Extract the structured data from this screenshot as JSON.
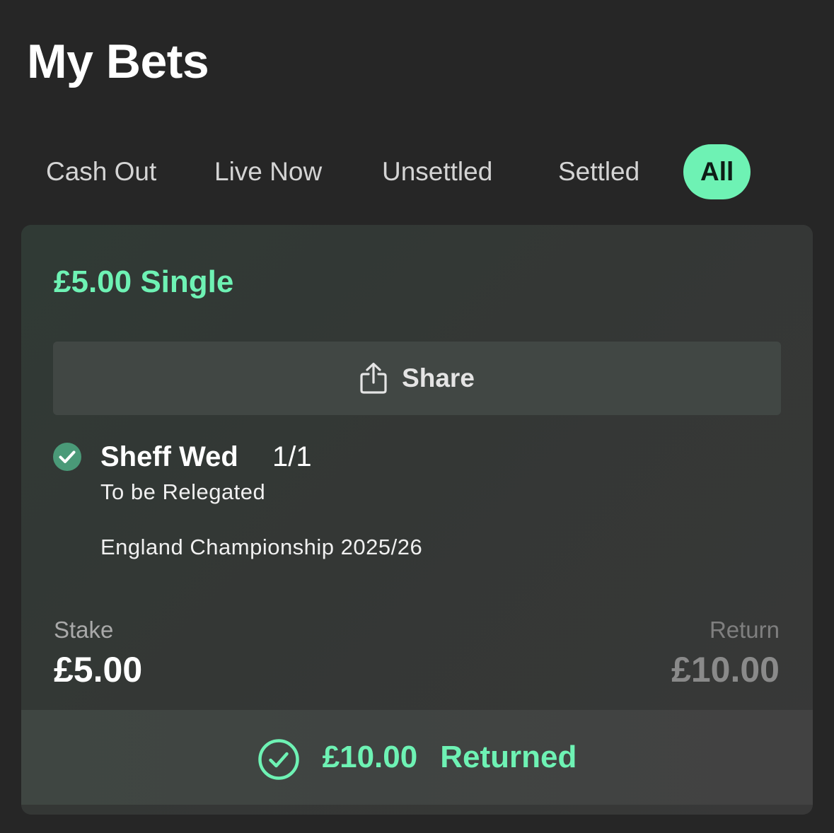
{
  "header": {
    "title": "My Bets"
  },
  "tabs": [
    {
      "label": "Cash Out",
      "active": false
    },
    {
      "label": "Live Now",
      "active": false
    },
    {
      "label": "Unsettled",
      "active": false
    },
    {
      "label": "Settled",
      "active": false
    },
    {
      "label": "All",
      "active": true
    }
  ],
  "bet": {
    "title": "£5.00 Single",
    "share_label": "Share",
    "selection": {
      "name": "Sheff Wed",
      "odds": "1/1",
      "market": "To be Relegated",
      "event": "England Championship 2025/26",
      "status_icon": "check-circle-filled-icon"
    },
    "stake_label": "Stake",
    "stake_value": "£5.00",
    "return_label": "Return",
    "return_value": "£10.00",
    "result": {
      "amount": "£10.00",
      "status": "Returned",
      "icon": "check-circle-outline-icon"
    }
  },
  "colors": {
    "accent": "#6ef2b4",
    "background": "#262626",
    "check_fill": "#4a9a78"
  }
}
